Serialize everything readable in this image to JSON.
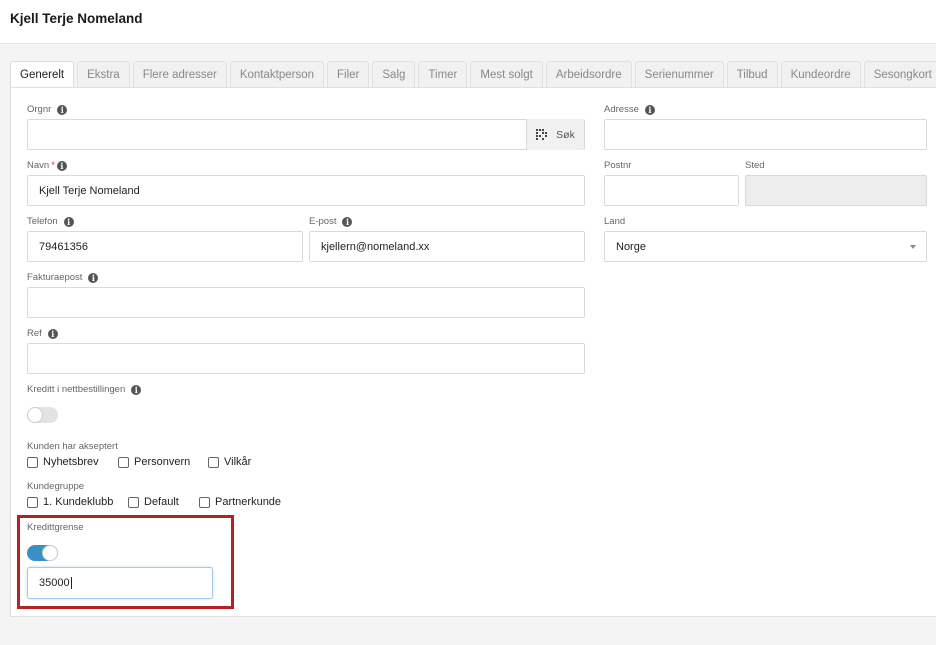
{
  "header": {
    "title": "Kjell Terje Nomeland"
  },
  "tabs": [
    {
      "label": "Generelt",
      "active": true
    },
    {
      "label": "Ekstra"
    },
    {
      "label": "Flere adresser"
    },
    {
      "label": "Kontaktperson"
    },
    {
      "label": "Filer"
    },
    {
      "label": "Salg"
    },
    {
      "label": "Timer"
    },
    {
      "label": "Mest solgt"
    },
    {
      "label": "Arbeidsordre"
    },
    {
      "label": "Serienummer"
    },
    {
      "label": "Tilbud"
    },
    {
      "label": "Kundeordre"
    },
    {
      "label": "Sesongkort"
    }
  ],
  "form": {
    "orgnr": {
      "label": "Orgnr",
      "value": "",
      "search_label": "Søk"
    },
    "navn": {
      "label": "Navn",
      "required_mark": "*",
      "value": "Kjell Terje Nomeland"
    },
    "telefon": {
      "label": "Telefon",
      "value": "79461356"
    },
    "epost": {
      "label": "E-post",
      "value": "kjellern@nomeland.xx"
    },
    "fakturaepost": {
      "label": "Fakturaepost",
      "value": ""
    },
    "ref": {
      "label": "Ref",
      "value": ""
    },
    "kreditt_nett": {
      "label": "Kreditt i nettbestillingen",
      "enabled": false
    },
    "akseptert": {
      "label": "Kunden har akseptert",
      "options": [
        "Nyhetsbrev",
        "Personvern",
        "Vilkår"
      ]
    },
    "kundegruppe": {
      "label": "Kundegruppe",
      "options": [
        "1. Kundeklubb",
        "Default",
        "Partnerkunde"
      ]
    },
    "kredittgrense": {
      "label": "Kredittgrense",
      "enabled": true,
      "value": "35000"
    },
    "adresse": {
      "label": "Adresse",
      "value": ""
    },
    "postnr": {
      "label": "Postnr",
      "value": ""
    },
    "sted": {
      "label": "Sted",
      "value": ""
    },
    "land": {
      "label": "Land",
      "value": "Norge"
    }
  },
  "colors": {
    "toggle_on": "#3a8fc4",
    "highlight_border": "#b52222"
  }
}
